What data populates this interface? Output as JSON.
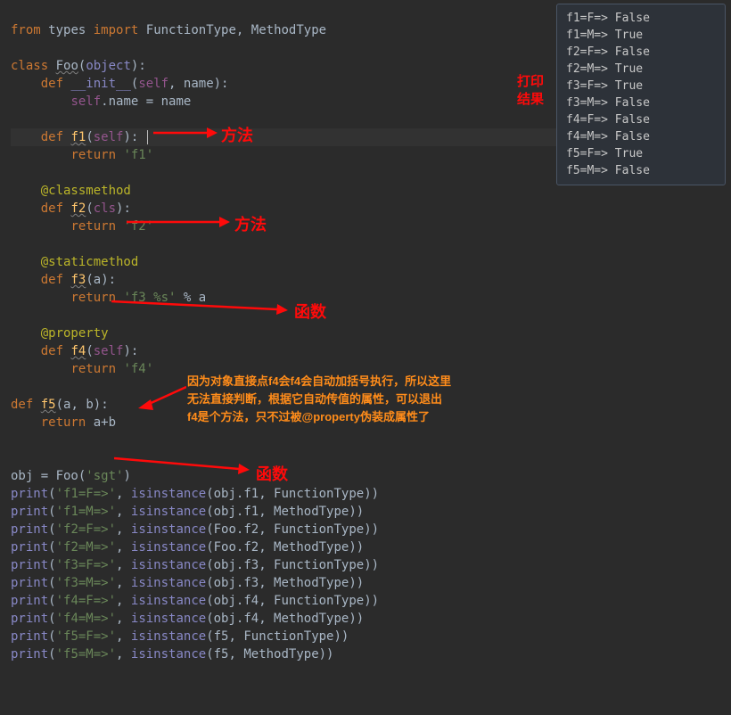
{
  "code": {
    "l1_from": "from",
    "l1_types": "types",
    "l1_import": "import",
    "l1_ft": "FunctionType",
    "l1_mt": "MethodType",
    "l3_class": "class",
    "l3_foo": "Foo",
    "l3_obj": "object",
    "l4_def": "def",
    "l4_init": "__init__",
    "l4_self": "self",
    "l4_name": "name",
    "l5_self": "self",
    "l5_attr": ".name = name",
    "l7_def": "def",
    "l7_f1": "f1",
    "l7_self": "self",
    "l8_return": "return",
    "l8_val": "'f1'",
    "l10_dec": "@classmethod",
    "l11_def": "def",
    "l11_f2": "f2",
    "l11_cls": "cls",
    "l12_return": "return",
    "l12_val": "'f2'",
    "l14_dec": "@staticmethod",
    "l15_def": "def",
    "l15_f3": "f3",
    "l15_a": "a",
    "l16_return": "return",
    "l16_val": "'f3 %s'",
    "l16_mod": " % a",
    "l18_dec": "@property",
    "l19_def": "def",
    "l19_f4": "f4",
    "l19_self": "self",
    "l20_return": "return",
    "l20_val": "'f4'",
    "l22_def": "def",
    "l22_f5": "f5",
    "l22_a": "a",
    "l22_b": "b",
    "l23_return": "return",
    "l23_val": "a+b",
    "l26_obj": "obj = Foo(",
    "l26_str": "'sgt'",
    "l26_end": ")",
    "p1": "print",
    "p1s": "'f1=F=>'",
    "p1b": "isinstance",
    "p1a": "(obj.f1, FunctionType))",
    "p2": "print",
    "p2s": "'f1=M=>'",
    "p2b": "isinstance",
    "p2a": "(obj.f1, MethodType))",
    "p3": "print",
    "p3s": "'f2=F=>'",
    "p3b": "isinstance",
    "p3a": "(Foo.f2, FunctionType))",
    "p4": "print",
    "p4s": "'f2=M=>'",
    "p4b": "isinstance",
    "p4a": "(Foo.f2, MethodType))",
    "p5": "print",
    "p5s": "'f3=F=>'",
    "p5b": "isinstance",
    "p5a": "(obj.f3, FunctionType))",
    "p6": "print",
    "p6s": "'f3=M=>'",
    "p6b": "isinstance",
    "p6a": "(obj.f3, MethodType))",
    "p7": "print",
    "p7s": "'f4=F=>'",
    "p7b": "isinstance",
    "p7a": "(obj.f4, FunctionType))",
    "p8": "print",
    "p8s": "'f4=M=>'",
    "p8b": "isinstance",
    "p8a": "(obj.f4, MethodType))",
    "p9": "print",
    "p9s": "'f5=F=>'",
    "p9b": "isinstance",
    "p9a": "(f5, FunctionType))",
    "p10": "print",
    "p10s": "'f5=M=>'",
    "p10b": "isinstance",
    "p10a": "(f5, MethodType))"
  },
  "output": {
    "lines": [
      "f1=F=>  False",
      "f1=M=>  True",
      "f2=F=>  False",
      "f2=M=>  True",
      "f3=F=>  True",
      "f3=M=>  False",
      "f4=F=>  False",
      "f4=M=>  False",
      "f5=F=>  True",
      "f5=M=>  False"
    ]
  },
  "annotations": {
    "result_label_l1": "打印",
    "result_label_l2": "结果",
    "f1_label": "方法",
    "f2_label": "方法",
    "f3_label": "函数",
    "f5_label": "函数",
    "f4_note_l1": "因为对象直接点f4会f4会自动加括号执行，所以这里",
    "f4_note_l2": "无法直接判断，根据它自动传值的属性，可以退出",
    "f4_note_l3": "f4是个方法，只不过被@property伪装成属性了"
  }
}
